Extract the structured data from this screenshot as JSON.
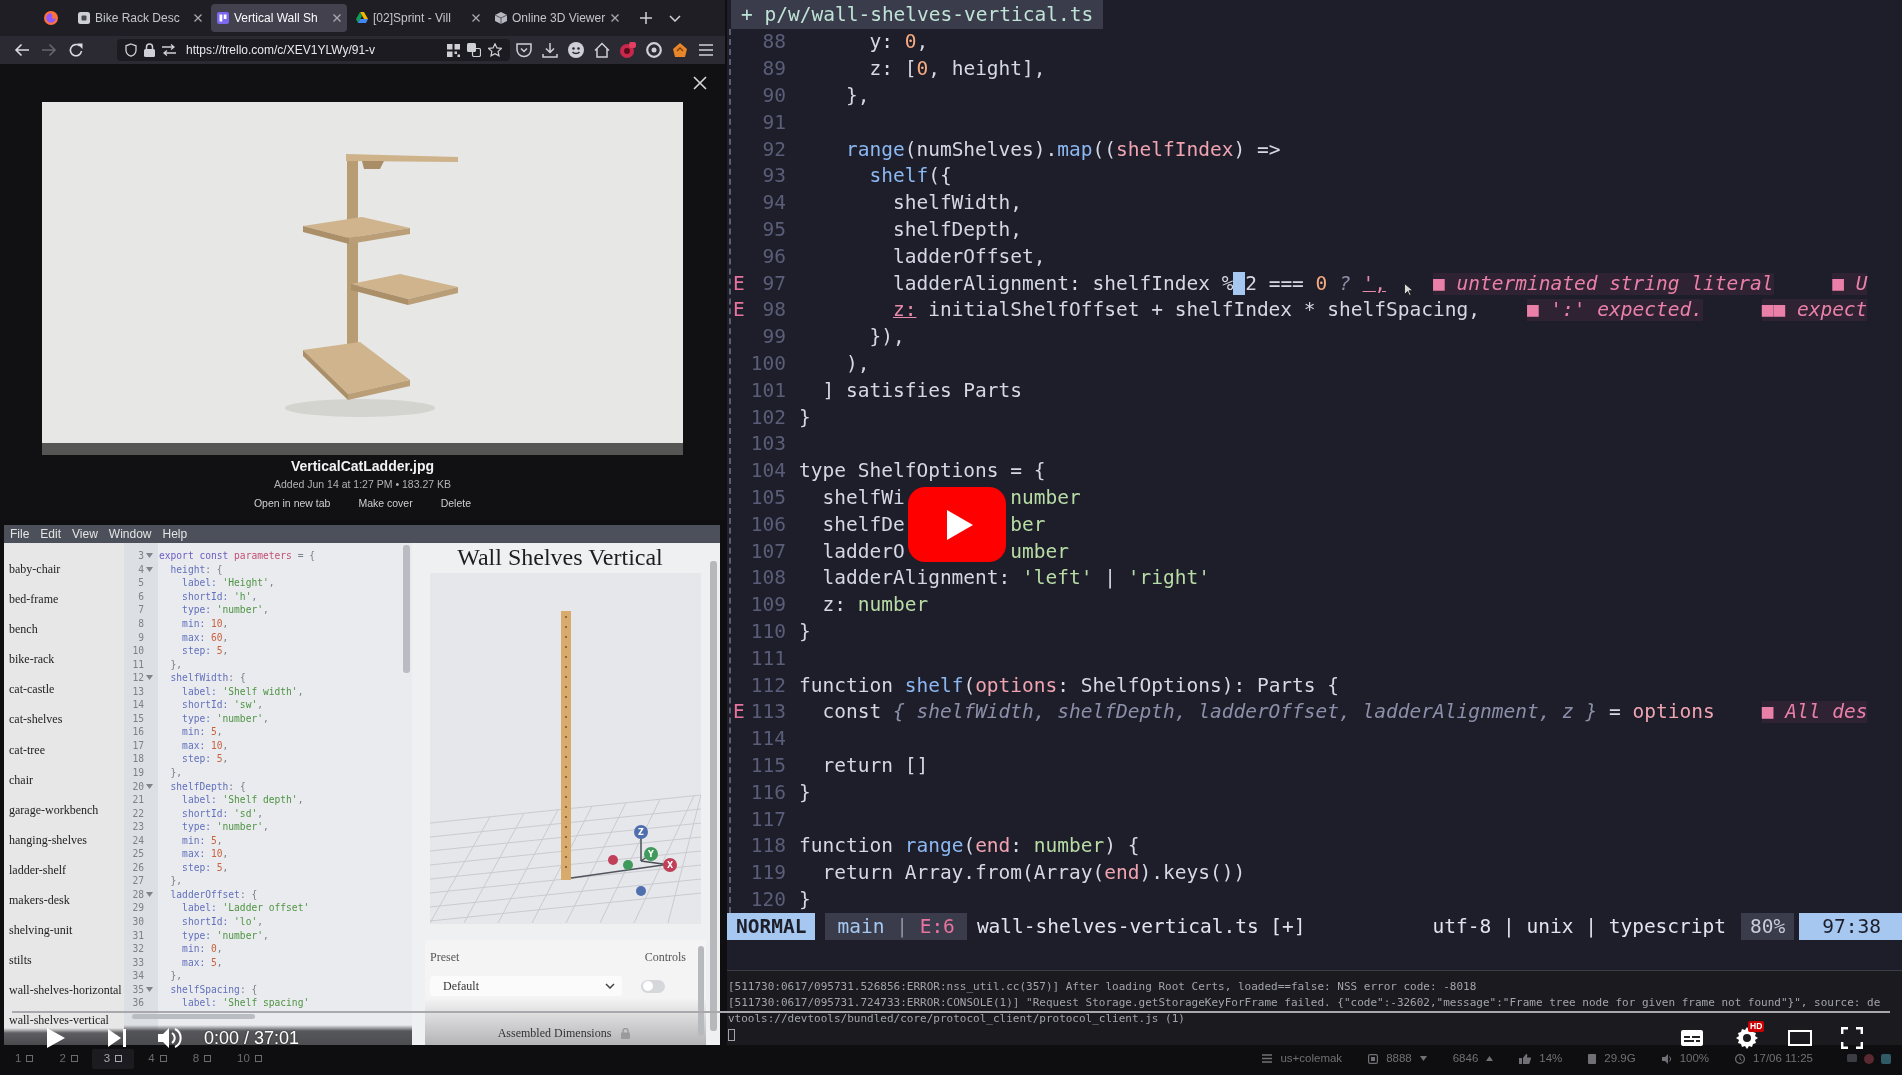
{
  "browser": {
    "tabs": [
      {
        "kind": "page",
        "title": "Bike Rack Desc",
        "selected": false
      },
      {
        "kind": "board",
        "title": "Vertical Wall Sh",
        "selected": true
      },
      {
        "kind": "drive",
        "title": "[02]Sprint - Vill",
        "selected": false
      },
      {
        "kind": "viewer",
        "title": "Online 3D Viewer",
        "selected": false
      }
    ],
    "nav": [
      {
        "kind": "back",
        "disabled": false
      },
      {
        "kind": "forward",
        "disabled": true
      },
      {
        "kind": "reload",
        "disabled": false
      }
    ],
    "url": "https://trello.com/c/XEV1YLWy/91-v",
    "attachment": {
      "file_name": "VerticalCatLadder.jpg",
      "details": "Added Jun 14 at 1:27 PM • 183.27 KB",
      "actions": [
        "Open in new tab",
        "Make cover",
        "Delete"
      ]
    }
  },
  "app": {
    "menu": [
      "File",
      "Edit",
      "View",
      "Window",
      "Help"
    ],
    "files": [
      "baby-chair",
      "bed-frame",
      "bench",
      "bike-rack",
      "cat-castle",
      "cat-shelves",
      "cat-tree",
      "chair",
      "garage-workbench",
      "hanging-shelves",
      "ladder-shelf",
      "makers-desk",
      "shelving-unit",
      "stilts",
      "wall-shelves-horizontal",
      "wall-shelves-vertical"
    ],
    "code": [
      {
        "number": "3",
        "foldable": true,
        "tokens": [
          {
            "text": "export const ",
            "kind": "keyword"
          },
          {
            "text": "parameters",
            "kind": "variable"
          },
          {
            "text": " = {",
            "kind": "punct"
          }
        ]
      },
      {
        "number": "4",
        "foldable": true,
        "tokens": [
          {
            "text": "  height",
            "kind": "property"
          },
          {
            "text": ": {",
            "kind": "punct"
          }
        ]
      },
      {
        "number": "5",
        "foldable": false,
        "tokens": [
          {
            "text": "    label: ",
            "kind": "property"
          },
          {
            "text": "'Height'",
            "kind": "string"
          },
          {
            "text": ",",
            "kind": "punct"
          }
        ]
      },
      {
        "number": "6",
        "foldable": false,
        "tokens": [
          {
            "text": "    shortId: ",
            "kind": "property"
          },
          {
            "text": "'h'",
            "kind": "string"
          },
          {
            "text": ",",
            "kind": "punct"
          }
        ]
      },
      {
        "number": "7",
        "foldable": false,
        "tokens": [
          {
            "text": "    type: ",
            "kind": "property"
          },
          {
            "text": "'number'",
            "kind": "string"
          },
          {
            "text": ",",
            "kind": "punct"
          }
        ]
      },
      {
        "number": "8",
        "foldable": false,
        "tokens": [
          {
            "text": "    min: ",
            "kind": "property"
          },
          {
            "text": "10",
            "kind": "number"
          },
          {
            "text": ",",
            "kind": "punct"
          }
        ]
      },
      {
        "number": "9",
        "foldable": false,
        "tokens": [
          {
            "text": "    max: ",
            "kind": "property"
          },
          {
            "text": "60",
            "kind": "number"
          },
          {
            "text": ",",
            "kind": "punct"
          }
        ]
      },
      {
        "number": "10",
        "foldable": false,
        "tokens": [
          {
            "text": "    step: ",
            "kind": "property"
          },
          {
            "text": "5",
            "kind": "number"
          },
          {
            "text": ",",
            "kind": "punct"
          }
        ]
      },
      {
        "number": "11",
        "foldable": false,
        "tokens": [
          {
            "text": "  },",
            "kind": "punct"
          }
        ]
      },
      {
        "number": "12",
        "foldable": true,
        "tokens": [
          {
            "text": "  shelfWidth",
            "kind": "property"
          },
          {
            "text": ": {",
            "kind": "punct"
          }
        ]
      },
      {
        "number": "13",
        "foldable": false,
        "tokens": [
          {
            "text": "    label: ",
            "kind": "property"
          },
          {
            "text": "'Shelf width'",
            "kind": "string"
          },
          {
            "text": ",",
            "kind": "punct"
          }
        ]
      },
      {
        "number": "14",
        "foldable": false,
        "tokens": [
          {
            "text": "    shortId: ",
            "kind": "property"
          },
          {
            "text": "'sw'",
            "kind": "string"
          },
          {
            "text": ",",
            "kind": "punct"
          }
        ]
      },
      {
        "number": "15",
        "foldable": false,
        "tokens": [
          {
            "text": "    type: ",
            "kind": "property"
          },
          {
            "text": "'number'",
            "kind": "string"
          },
          {
            "text": ",",
            "kind": "punct"
          }
        ]
      },
      {
        "number": "16",
        "foldable": false,
        "tokens": [
          {
            "text": "    min: ",
            "kind": "property"
          },
          {
            "text": "5",
            "kind": "number"
          },
          {
            "text": ",",
            "kind": "punct"
          }
        ]
      },
      {
        "number": "17",
        "foldable": false,
        "tokens": [
          {
            "text": "    max: ",
            "kind": "property"
          },
          {
            "text": "10",
            "kind": "number"
          },
          {
            "text": ",",
            "kind": "punct"
          }
        ]
      },
      {
        "number": "18",
        "foldable": false,
        "tokens": [
          {
            "text": "    step: ",
            "kind": "property"
          },
          {
            "text": "5",
            "kind": "number"
          },
          {
            "text": ",",
            "kind": "punct"
          }
        ]
      },
      {
        "number": "19",
        "foldable": false,
        "tokens": [
          {
            "text": "  },",
            "kind": "punct"
          }
        ]
      },
      {
        "number": "20",
        "foldable": true,
        "tokens": [
          {
            "text": "  shelfDepth",
            "kind": "property"
          },
          {
            "text": ": {",
            "kind": "punct"
          }
        ]
      },
      {
        "number": "21",
        "foldable": false,
        "tokens": [
          {
            "text": "    label: ",
            "kind": "property"
          },
          {
            "text": "'Shelf depth'",
            "kind": "string"
          },
          {
            "text": ",",
            "kind": "punct"
          }
        ]
      },
      {
        "number": "22",
        "foldable": false,
        "tokens": [
          {
            "text": "    shortId: ",
            "kind": "property"
          },
          {
            "text": "'sd'",
            "kind": "string"
          },
          {
            "text": ",",
            "kind": "punct"
          }
        ]
      },
      {
        "number": "23",
        "foldable": false,
        "tokens": [
          {
            "text": "    type: ",
            "kind": "property"
          },
          {
            "text": "'number'",
            "kind": "string"
          },
          {
            "text": ",",
            "kind": "punct"
          }
        ]
      },
      {
        "number": "24",
        "foldable": false,
        "tokens": [
          {
            "text": "    min: ",
            "kind": "property"
          },
          {
            "text": "5",
            "kind": "number"
          },
          {
            "text": ",",
            "kind": "punct"
          }
        ]
      },
      {
        "number": "25",
        "foldable": false,
        "tokens": [
          {
            "text": "    max: ",
            "kind": "property"
          },
          {
            "text": "10",
            "kind": "number"
          },
          {
            "text": ",",
            "kind": "punct"
          }
        ]
      },
      {
        "number": "26",
        "foldable": false,
        "tokens": [
          {
            "text": "    step: ",
            "kind": "property"
          },
          {
            "text": "5",
            "kind": "number"
          },
          {
            "text": ",",
            "kind": "punct"
          }
        ]
      },
      {
        "number": "27",
        "foldable": false,
        "tokens": [
          {
            "text": "  },",
            "kind": "punct"
          }
        ]
      },
      {
        "number": "28",
        "foldable": true,
        "tokens": [
          {
            "text": "  ladderOffset",
            "kind": "property"
          },
          {
            "text": ": {",
            "kind": "punct"
          }
        ]
      },
      {
        "number": "29",
        "foldable": false,
        "tokens": [
          {
            "text": "    label: ",
            "kind": "property"
          },
          {
            "text": "'Ladder offset'",
            "kind": "string"
          }
        ]
      },
      {
        "number": "30",
        "foldable": false,
        "tokens": [
          {
            "text": "    shortId: ",
            "kind": "property"
          },
          {
            "text": "'lo'",
            "kind": "string"
          },
          {
            "text": ",",
            "kind": "punct"
          }
        ]
      },
      {
        "number": "31",
        "foldable": false,
        "tokens": [
          {
            "text": "    type: ",
            "kind": "property"
          },
          {
            "text": "'number'",
            "kind": "string"
          },
          {
            "text": ",",
            "kind": "punct"
          }
        ]
      },
      {
        "number": "32",
        "foldable": false,
        "tokens": [
          {
            "text": "    min: ",
            "kind": "property"
          },
          {
            "text": "0",
            "kind": "number"
          },
          {
            "text": ",",
            "kind": "punct"
          }
        ]
      },
      {
        "number": "33",
        "foldable": false,
        "tokens": [
          {
            "text": "    max: ",
            "kind": "property"
          },
          {
            "text": "5",
            "kind": "number"
          },
          {
            "text": ",",
            "kind": "punct"
          }
        ]
      },
      {
        "number": "34",
        "foldable": false,
        "tokens": [
          {
            "text": "  },",
            "kind": "punct"
          }
        ]
      },
      {
        "number": "35",
        "foldable": true,
        "tokens": [
          {
            "text": "  shelfSpacing",
            "kind": "property"
          },
          {
            "text": ": {",
            "kind": "punct"
          }
        ]
      },
      {
        "number": "36",
        "foldable": false,
        "tokens": [
          {
            "text": "    label: ",
            "kind": "property"
          },
          {
            "text": "'Shelf spacing'",
            "kind": "string"
          }
        ]
      }
    ],
    "viewer": {
      "title": "Wall Shelves Vertical",
      "axes": [
        {
          "label": "Z",
          "color": "#4f6fae"
        },
        {
          "label": "Y",
          "color": "#3f9a5c"
        },
        {
          "label": "X",
          "color": "#c0405a"
        }
      ],
      "preset": {
        "label": "Preset",
        "value": "Default"
      },
      "controls": {
        "label": "Controls",
        "on": false
      },
      "section": "Assembled Dimensions"
    }
  },
  "editor": {
    "tab": "+ p/w/wall-shelves-vertical.ts",
    "lines": [
      {
        "number": "88",
        "tokens": [
          {
            "text": "      y: ",
            "kind": "plain"
          },
          {
            "text": "0",
            "kind": "number"
          },
          {
            "text": ",",
            "kind": "plain"
          }
        ]
      },
      {
        "number": "89",
        "tokens": [
          {
            "text": "      z: [",
            "kind": "plain"
          },
          {
            "text": "0",
            "kind": "number"
          },
          {
            "text": ", height],",
            "kind": "plain"
          }
        ]
      },
      {
        "number": "90",
        "tokens": [
          {
            "text": "    },",
            "kind": "plain"
          }
        ]
      },
      {
        "number": "91"
      },
      {
        "number": "92",
        "tokens": [
          {
            "text": "    range",
            "kind": "function"
          },
          {
            "text": "(numShelves).",
            "kind": "plain"
          },
          {
            "text": "map",
            "kind": "function"
          },
          {
            "text": "((",
            "kind": "plain"
          },
          {
            "text": "shelfIndex",
            "kind": "param"
          },
          {
            "text": ") =>",
            "kind": "plain"
          }
        ]
      },
      {
        "number": "93",
        "tokens": [
          {
            "text": "      shelf",
            "kind": "function"
          },
          {
            "text": "({",
            "kind": "plain"
          }
        ]
      },
      {
        "number": "94",
        "tokens": [
          {
            "text": "        shelfWidth,",
            "kind": "plain"
          }
        ]
      },
      {
        "number": "95",
        "tokens": [
          {
            "text": "        shelfDepth,",
            "kind": "plain"
          }
        ]
      },
      {
        "number": "96",
        "tokens": [
          {
            "text": "        ladderOffset,",
            "kind": "plain"
          }
        ]
      },
      {
        "number": "97",
        "sign": "E",
        "tokens": [
          {
            "text": "        ladderAlignment: shelfIndex %",
            "kind": "plain"
          },
          {
            "text": " 2",
            "kind": "cursor"
          },
          {
            "text": " === ",
            "kind": "plain"
          },
          {
            "text": "0",
            "kind": "number"
          },
          {
            "text": " ? ",
            "kind": "muted"
          },
          {
            "text": "',",
            "kind": "error"
          }
        ],
        "diagnostics": [
          "■ unterminated string literal",
          "■ U"
        ]
      },
      {
        "number": "98",
        "sign": "E",
        "tokens": [
          {
            "text": "        z:",
            "kind": "error"
          },
          {
            "text": " initialShelfOffset + shelfIndex * shelfSpacing,",
            "kind": "plain"
          }
        ],
        "diagnostics": [
          "■ ':' expected.",
          "■■ expect"
        ]
      },
      {
        "number": "99",
        "tokens": [
          {
            "text": "      }),",
            "kind": "plain"
          }
        ]
      },
      {
        "number": "100",
        "tokens": [
          {
            "text": "    ),",
            "kind": "plain"
          }
        ]
      },
      {
        "number": "101",
        "tokens": [
          {
            "text": "  ] satisfies Parts",
            "kind": "plain"
          }
        ]
      },
      {
        "number": "102",
        "tokens": [
          {
            "text": "}",
            "kind": "plain"
          }
        ]
      },
      {
        "number": "103"
      },
      {
        "number": "104",
        "tokens": [
          {
            "text": "type ShelfOptions = {",
            "kind": "plain"
          }
        ]
      },
      {
        "number": "105",
        "tokens": [
          {
            "text": "  shelfWi",
            "kind": "plain"
          }
        ],
        "tail": [
          {
            "text": "number",
            "kind": "type"
          }
        ]
      },
      {
        "number": "106",
        "tokens": [
          {
            "text": "  shelfDe",
            "kind": "plain"
          }
        ],
        "tail": [
          {
            "text": "ber",
            "kind": "type"
          }
        ]
      },
      {
        "number": "107",
        "tokens": [
          {
            "text": "  ladderO",
            "kind": "plain"
          }
        ],
        "tail": [
          {
            "text": "umber",
            "kind": "type"
          }
        ]
      },
      {
        "number": "108",
        "tokens": [
          {
            "text": "  ladderAlignment: ",
            "kind": "plain"
          },
          {
            "text": "'left'",
            "kind": "string"
          },
          {
            "text": " | ",
            "kind": "plain"
          },
          {
            "text": "'right'",
            "kind": "string"
          }
        ]
      },
      {
        "number": "109",
        "tokens": [
          {
            "text": "  z: ",
            "kind": "plain"
          },
          {
            "text": "number",
            "kind": "type"
          }
        ]
      },
      {
        "number": "110",
        "tokens": [
          {
            "text": "}",
            "kind": "plain"
          }
        ]
      },
      {
        "number": "111"
      },
      {
        "number": "112",
        "tokens": [
          {
            "text": "function ",
            "kind": "plain"
          },
          {
            "text": "shelf",
            "kind": "function"
          },
          {
            "text": "(",
            "kind": "plain"
          },
          {
            "text": "options",
            "kind": "param"
          },
          {
            "text": ": ShelfOptions): Parts {",
            "kind": "plain"
          }
        ]
      },
      {
        "number": "113",
        "sign": "E",
        "tokens": [
          {
            "text": "  const ",
            "kind": "plain"
          },
          {
            "text": "{ shelfWidth, shelfDepth, ladderOffset, ladderAlignment, z }",
            "kind": "muted"
          },
          {
            "text": " = ",
            "kind": "plain"
          },
          {
            "text": "options",
            "kind": "param"
          }
        ],
        "diagnostics": [
          "■ All des"
        ]
      },
      {
        "number": "114"
      },
      {
        "number": "115",
        "tokens": [
          {
            "text": "  return []",
            "kind": "plain"
          }
        ]
      },
      {
        "number": "116",
        "tokens": [
          {
            "text": "}",
            "kind": "plain"
          }
        ]
      },
      {
        "number": "117"
      },
      {
        "number": "118",
        "tokens": [
          {
            "text": "function ",
            "kind": "plain"
          },
          {
            "text": "range",
            "kind": "function"
          },
          {
            "text": "(",
            "kind": "plain"
          },
          {
            "text": "end",
            "kind": "param"
          },
          {
            "text": ": ",
            "kind": "plain"
          },
          {
            "text": "number",
            "kind": "type"
          },
          {
            "text": ") {",
            "kind": "plain"
          }
        ]
      },
      {
        "number": "119",
        "tokens": [
          {
            "text": "  return Array.from(Array(",
            "kind": "plain"
          },
          {
            "text": "end",
            "kind": "param"
          },
          {
            "text": ").keys())",
            "kind": "plain"
          }
        ]
      },
      {
        "number": "120",
        "tokens": [
          {
            "text": "}",
            "kind": "plain"
          }
        ]
      }
    ],
    "status": {
      "mode": "NORMAL",
      "branch": "main",
      "divider": "|",
      "errors": "E:6",
      "file": "wall-shelves-vertical.ts [+]",
      "format": "utf-8 | unix | typescript",
      "percent": "80%",
      "position": "97:38"
    }
  },
  "terminal": {
    "lines": [
      "[511730:0617/095731.526856:ERROR:nss_util.cc(357)] After loading Root Certs, loaded==false: NSS error code: -8018",
      "[511730:0617/095731.724733:ERROR:CONSOLE(1)] \"Request Storage.getStorageKeyForFrame failed. {\"code\":-32602,\"message\":\"Frame tree node for given frame not found\"}\", source: de",
      "vtools://devtools/bundled/core/protocol_client/protocol_client.js (1)"
    ]
  },
  "player": {
    "time": "0:00 / 37:01",
    "badge": "HD"
  },
  "taskbar": {
    "workspaces": [
      {
        "label": "1",
        "selected": false
      },
      {
        "label": "2",
        "selected": false
      },
      {
        "label": "3",
        "selected": true
      },
      {
        "label": "4",
        "selected": false
      },
      {
        "label": "8",
        "selected": false
      },
      {
        "label": "10",
        "selected": false
      }
    ],
    "status": [
      {
        "kind": "keyboard",
        "text": "us+colemak"
      },
      {
        "kind": "download",
        "text": "8888"
      },
      {
        "kind": "upload",
        "text": "6846"
      },
      {
        "kind": "cpu",
        "text": "14%"
      },
      {
        "kind": "disk",
        "text": "29.9G"
      },
      {
        "kind": "volume",
        "text": "100%"
      },
      {
        "kind": "clock",
        "text": "17/06 11:25"
      }
    ]
  }
}
